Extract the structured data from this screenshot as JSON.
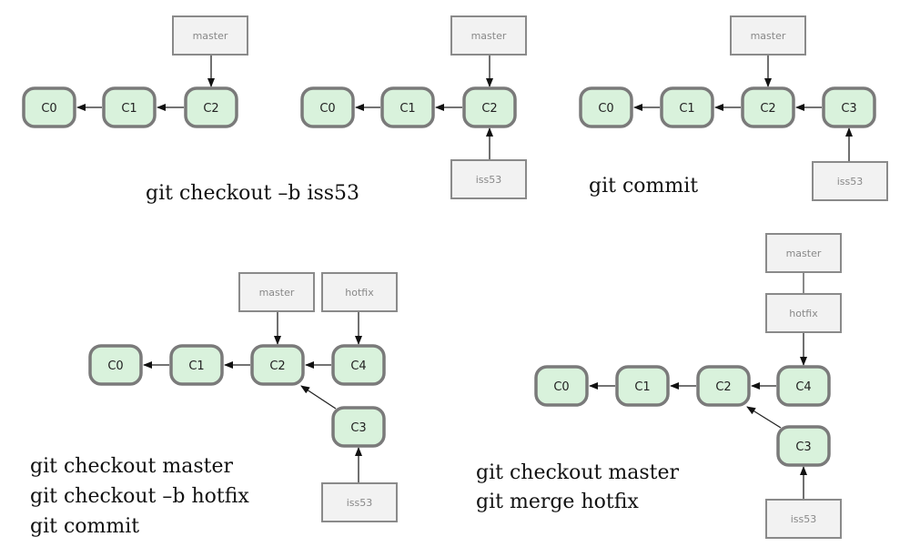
{
  "panels": [
    {
      "commits": [
        "C0",
        "C1",
        "C2"
      ],
      "refs": [
        "master"
      ],
      "caption": []
    },
    {
      "commits": [
        "C0",
        "C1",
        "C2"
      ],
      "refs": [
        "master",
        "iss53"
      ],
      "caption": [
        "git  checkout –b iss53"
      ]
    },
    {
      "commits": [
        "C0",
        "C1",
        "C2",
        "C3"
      ],
      "refs": [
        "master",
        "iss53"
      ],
      "caption": [
        "git  commit"
      ]
    },
    {
      "commits": [
        "C0",
        "C1",
        "C2",
        "C4",
        "C3"
      ],
      "refs": [
        "master",
        "hotfix",
        "iss53"
      ],
      "caption": [
        "git checkout master",
        "git checkout –b hotfix",
        "git commit"
      ]
    },
    {
      "commits": [
        "C0",
        "C1",
        "C2",
        "C4",
        "C3"
      ],
      "refs": [
        "master",
        "hotfix",
        "iss53"
      ],
      "caption": [
        "git checkout master",
        "git merge hotfix"
      ]
    }
  ],
  "colors": {
    "commit_fill": "#d9f2dc",
    "commit_stroke": "#7a7a7a",
    "ref_fill": "#f2f2f2",
    "ref_stroke": "#8a8a8a"
  }
}
